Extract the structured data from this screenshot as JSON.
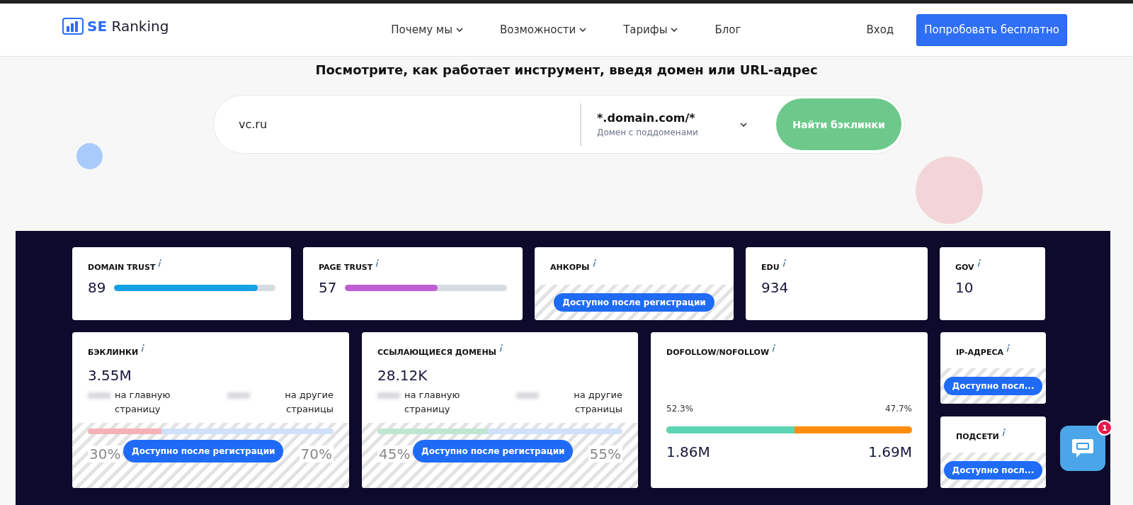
{
  "header": {
    "logo": {
      "brand_bold": "SE",
      "brand": "Ranking"
    },
    "nav": [
      {
        "label": "Почему мы",
        "dropdown": true
      },
      {
        "label": "Возможности",
        "dropdown": true
      },
      {
        "label": "Тарифы",
        "dropdown": true
      },
      {
        "label": "Блог",
        "dropdown": false
      }
    ],
    "login": "Вход",
    "cta": "Попробовать бесплатно"
  },
  "hero": {
    "title": "Посмотрите, как работает инструмент, введя домен или URL-адрес",
    "search": {
      "value": "vc.ru",
      "scope_title": "*.domain.com/*",
      "scope_hint": "Домен с поддоменами",
      "button": "Найти бэклинки"
    }
  },
  "row_1": [
    {
      "kind": "bar",
      "label": "DOMAIN TRUST",
      "value": "89",
      "level": 0.89,
      "color": "#16a1e3"
    },
    {
      "kind": "bar",
      "label": "PAGE TRUST",
      "value": "57",
      "level": 0.57,
      "color": "#bf5ed3"
    },
    {
      "kind": "locked",
      "label": "АНКОРЫ",
      "button": "Доступно после регистрации"
    },
    {
      "kind": "number",
      "label": "EDU",
      "value": "934"
    },
    {
      "kind": "number",
      "label": "GOV",
      "value": "10"
    }
  ],
  "row_2": [
    {
      "kind": "split",
      "label": "БЭКЛИНКИ",
      "value": "3.55M",
      "left_text": "на главную страницу",
      "right_text": "на другие страницы",
      "level": 0.3,
      "color": "#f4b2b6",
      "left_pct": "30%",
      "right_pct": "70%",
      "button": "Доступно после регистрации"
    },
    {
      "kind": "split",
      "label": "ССЫЛАЮЩИЕСЯ ДОМЕНЫ",
      "value": "28.12K",
      "left_text": "на главную страницу",
      "right_text": "на другие страницы",
      "level": 0.45,
      "color": "#bfe6d2",
      "left_pct": "45%",
      "right_pct": "55%",
      "button": "Доступно после регистрации"
    },
    {
      "kind": "ratio",
      "label": "DOFOLLOW/NOFOLLOW",
      "left_pct": "52.3%",
      "right_pct": "47.7%",
      "level": 0.523,
      "left_value": "1.86M",
      "right_value": "1.69M"
    },
    {
      "kind": "stack",
      "cards": [
        {
          "label": "IP-АДРЕСА",
          "button": "Доступно посл..."
        },
        {
          "label": "ПОДСЕТИ",
          "button": "Доступно посл..."
        }
      ]
    }
  ],
  "chat": {
    "badge": "1"
  }
}
